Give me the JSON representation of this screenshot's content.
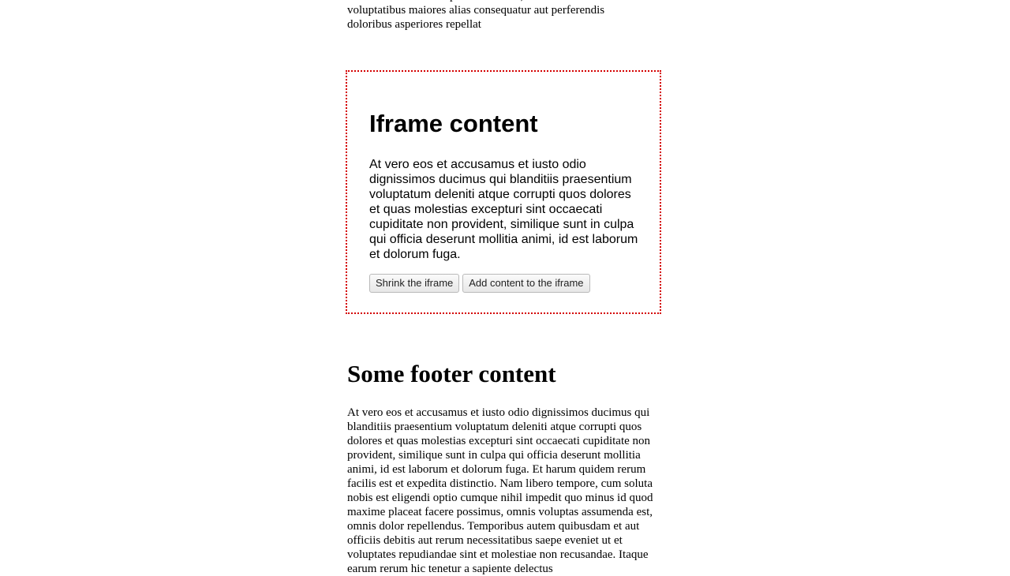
{
  "top_section": {
    "paragraph_tail": "rerum hic tenetur a sapiente delectus, ut aut reiciendis voluptatibus maiores alias consequatur aut perferendis doloribus asperiores repellat"
  },
  "iframe": {
    "title": "Iframe content",
    "paragraph": "At vero eos et accusamus et iusto odio dignissimos ducimus qui blanditiis praesentium voluptatum deleniti atque corrupti quos dolores et quas molestias excepturi sint occaecati cupiditate non provident, similique sunt in culpa qui officia deserunt mollitia animi, id est laborum et dolorum fuga.",
    "buttons": {
      "shrink_label": "Shrink the iframe",
      "add_content_label": "Add content to the iframe"
    },
    "border_color": "#d40000"
  },
  "footer": {
    "title": "Some footer content",
    "paragraph": "At vero eos et accusamus et iusto odio dignissimos ducimus qui blanditiis praesentium voluptatum deleniti atque corrupti quos dolores et quas molestias excepturi sint occaecati cupiditate non provident, similique sunt in culpa qui officia deserunt mollitia animi, id est laborum et dolorum fuga. Et harum quidem rerum facilis est et expedita distinctio. Nam libero tempore, cum soluta nobis est eligendi optio cumque nihil impedit quo minus id quod maxime placeat facere possimus, omnis voluptas assumenda est, omnis dolor repellendus. Temporibus autem quibusdam et aut officiis debitis aut rerum necessitatibus saepe eveniet ut et voluptates repudiandae sint et molestiae non recusandae. Itaque earum rerum hic tenetur a sapiente delectus"
  }
}
